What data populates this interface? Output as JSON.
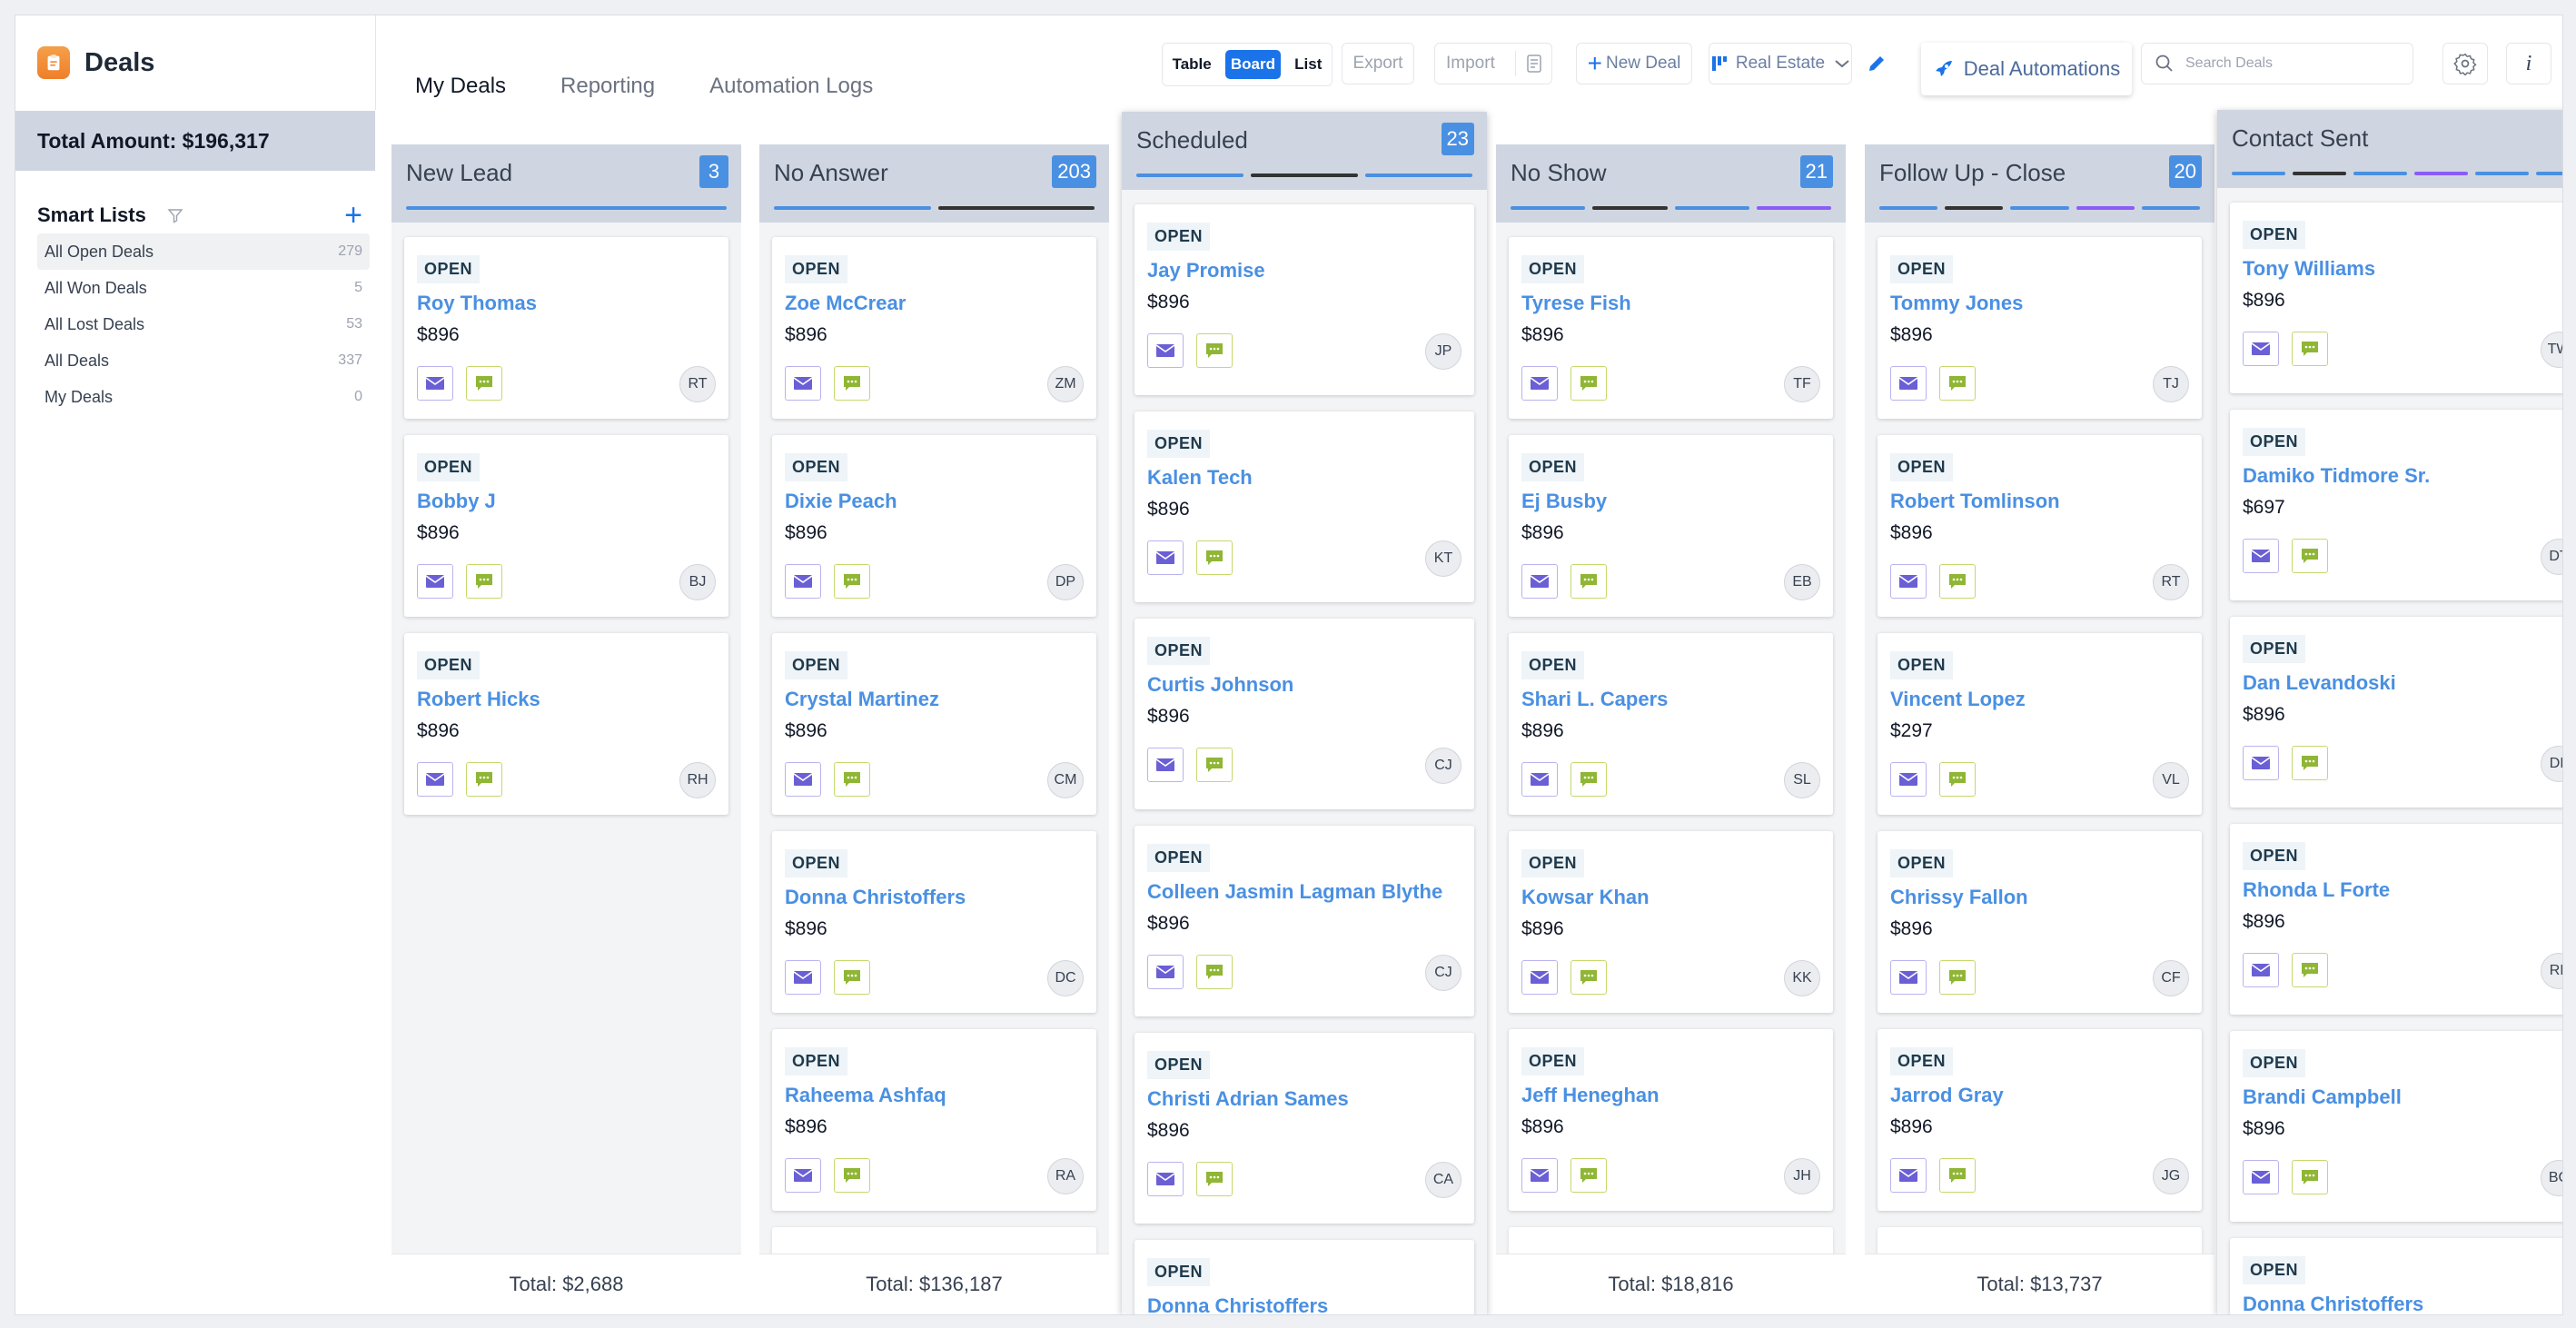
{
  "sidebar": {
    "title": "Deals",
    "total_amount": "Total Amount: $196,317",
    "smart_lists_title": "Smart Lists",
    "add_label": "+",
    "items": [
      {
        "label": "All Open Deals",
        "count": "279",
        "active": true
      },
      {
        "label": "All Won Deals",
        "count": "5"
      },
      {
        "label": "All Lost Deals",
        "count": "53"
      },
      {
        "label": "All Deals",
        "count": "337"
      },
      {
        "label": "My Deals",
        "count": "0"
      }
    ]
  },
  "header": {
    "tabs": [
      {
        "label": "My Deals",
        "active": true
      },
      {
        "label": "Reporting"
      },
      {
        "label": "Automation Logs"
      }
    ],
    "view_toggle": {
      "table": "Table",
      "board": "Board",
      "list": "List"
    },
    "export_label": "Export",
    "import_label": "Import",
    "new_deal_label": "New Deal",
    "pipeline_label": "Real Estate",
    "automations_label": "Deal Automations",
    "search_placeholder": "Search Deals",
    "info_label": "i"
  },
  "colors": {
    "accent": "#1a73e8",
    "card_name": "#4a90e2",
    "count_badge": "#4a90e2",
    "column_header": "#cfd6e1"
  },
  "columns": [
    {
      "title": "New Lead",
      "count": "3",
      "total": "Total: $2,688",
      "bars": [
        "#4a90e2"
      ],
      "cards": [
        {
          "status": "OPEN",
          "name": "Roy Thomas",
          "amount": "$896",
          "initials": "RT"
        },
        {
          "status": "OPEN",
          "name": "Bobby J",
          "amount": "$896",
          "initials": "BJ"
        },
        {
          "status": "OPEN",
          "name": "Robert Hicks",
          "amount": "$896",
          "initials": "RH"
        }
      ]
    },
    {
      "title": "No Answer",
      "count": "203",
      "total": "Total: $136,187",
      "bars": [
        "#4a90e2",
        "#333333"
      ],
      "cards": [
        {
          "status": "OPEN",
          "name": "Zoe McCrear",
          "amount": "$896",
          "initials": "ZM"
        },
        {
          "status": "OPEN",
          "name": "Dixie Peach",
          "amount": "$896",
          "initials": "DP"
        },
        {
          "status": "OPEN",
          "name": "Crystal Martinez",
          "amount": "$896",
          "initials": "CM"
        },
        {
          "status": "OPEN",
          "name": "Donna Christoffers",
          "amount": "$896",
          "initials": "DC"
        },
        {
          "status": "OPEN",
          "name": "Raheema Ashfaq",
          "amount": "$896",
          "initials": "RA"
        }
      ]
    },
    {
      "title": "Scheduled",
      "count": "23",
      "total": "",
      "bars": [
        "#4a90e2",
        "#333333",
        "#4a90e2"
      ],
      "cards": [
        {
          "status": "OPEN",
          "name": "Jay Promise",
          "amount": "$896",
          "initials": "JP"
        },
        {
          "status": "OPEN",
          "name": "Kalen Tech",
          "amount": "$896",
          "initials": "KT"
        },
        {
          "status": "OPEN",
          "name": "Curtis Johnson",
          "amount": "$896",
          "initials": "CJ"
        },
        {
          "status": "OPEN",
          "name": "Colleen Jasmin Lagman Blythe",
          "amount": "$896",
          "initials": "CJ"
        },
        {
          "status": "OPEN",
          "name": "Christi Adrian Sames",
          "amount": "$896",
          "initials": "CA"
        },
        {
          "status": "OPEN",
          "name": "Donna Christoffers",
          "amount": "",
          "initials": ""
        }
      ]
    },
    {
      "title": "No Show",
      "count": "21",
      "total": "Total: $18,816",
      "bars": [
        "#4a90e2",
        "#333333",
        "#4a90e2",
        "#8b5cf6"
      ],
      "cards": [
        {
          "status": "OPEN",
          "name": "Tyrese Fish",
          "amount": "$896",
          "initials": "TF"
        },
        {
          "status": "OPEN",
          "name": "Ej Busby",
          "amount": "$896",
          "initials": "EB"
        },
        {
          "status": "OPEN",
          "name": "Shari L. Capers",
          "amount": "$896",
          "initials": "SL"
        },
        {
          "status": "OPEN",
          "name": "Kowsar Khan",
          "amount": "$896",
          "initials": "KK"
        },
        {
          "status": "OPEN",
          "name": "Jeff Heneghan",
          "amount": "$896",
          "initials": "JH"
        }
      ]
    },
    {
      "title": "Follow Up - Close",
      "count": "20",
      "total": "Total: $13,737",
      "bars": [
        "#4a90e2",
        "#333333",
        "#4a90e2",
        "#8b5cf6",
        "#4a90e2"
      ],
      "cards": [
        {
          "status": "OPEN",
          "name": "Tommy Jones",
          "amount": "$896",
          "initials": "TJ"
        },
        {
          "status": "OPEN",
          "name": "Robert Tomlinson",
          "amount": "$896",
          "initials": "RT"
        },
        {
          "status": "OPEN",
          "name": "Vincent Lopez",
          "amount": "$297",
          "initials": "VL"
        },
        {
          "status": "OPEN",
          "name": "Chrissy Fallon",
          "amount": "$896",
          "initials": "CF"
        },
        {
          "status": "OPEN",
          "name": "Jarrod Gray",
          "amount": "$896",
          "initials": "JG"
        }
      ]
    },
    {
      "title": "Contact Sent",
      "count": "",
      "total": "",
      "bars": [
        "#4a90e2",
        "#333333",
        "#4a90e2",
        "#8b5cf6",
        "#4a90e2",
        "#4a90e2"
      ],
      "cards": [
        {
          "status": "OPEN",
          "name": "Tony Williams",
          "amount": "$896",
          "initials": "TW"
        },
        {
          "status": "OPEN",
          "name": "Damiko Tidmore Sr.",
          "amount": "$697",
          "initials": "DT"
        },
        {
          "status": "OPEN",
          "name": "Dan Levandoski",
          "amount": "$896",
          "initials": "DL"
        },
        {
          "status": "OPEN",
          "name": "Rhonda L Forte",
          "amount": "$896",
          "initials": "RL"
        },
        {
          "status": "OPEN",
          "name": "Brandi Campbell",
          "amount": "$896",
          "initials": "BC"
        },
        {
          "status": "OPEN",
          "name": "Donna Christoffers",
          "amount": "",
          "initials": ""
        }
      ]
    }
  ]
}
